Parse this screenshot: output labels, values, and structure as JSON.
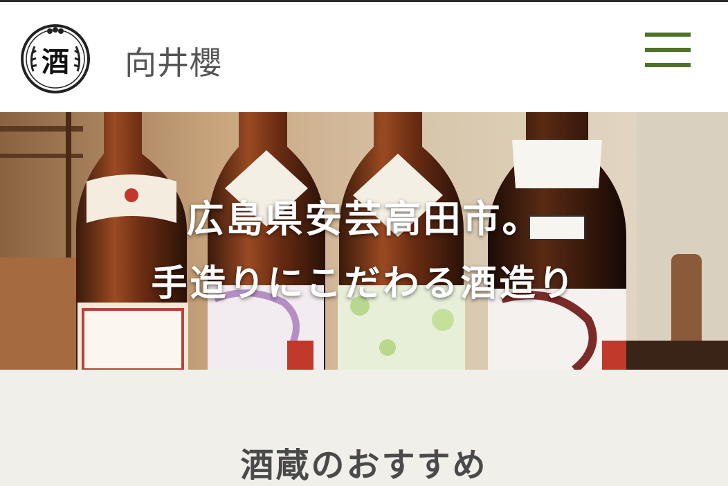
{
  "header": {
    "logo_text": "酒",
    "brand_name": "向井櫻",
    "menu_icon": "hamburger-menu-icon",
    "menu_color": "#4f7229"
  },
  "hero": {
    "line1": "広島県安芸高田市。",
    "line2": "手造りにこだわる酒造り"
  },
  "section": {
    "title": "酒蔵のおすすめ"
  }
}
